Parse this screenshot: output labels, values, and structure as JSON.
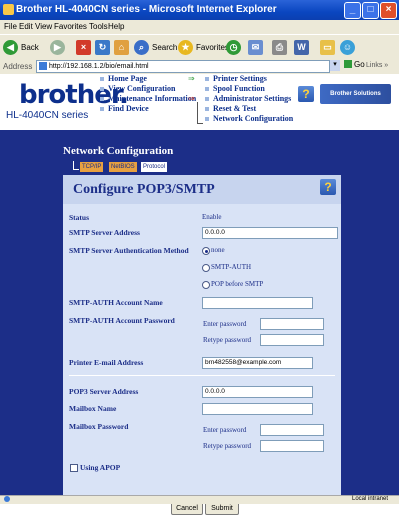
{
  "window": {
    "title": "Brother HL-4040CN series - Microsoft Internet Explorer",
    "buttons": {
      "minimize": "_",
      "maximize": "□",
      "close": "×"
    }
  },
  "menu": [
    "File",
    "Edit",
    "View",
    "Favorites",
    "Tools",
    "Help"
  ],
  "toolbar": {
    "back_label": "Back",
    "search_label": "Search",
    "favorites_label": "Favorites"
  },
  "address": {
    "label": "Address",
    "url": "http://192.168.1.2/bio/email.html",
    "go_label": "Go",
    "links_label": "Links »"
  },
  "brand": {
    "logo": "brother.",
    "model": "HL-4040CN series",
    "solutions_center": "Brother Solutions Center"
  },
  "nav": {
    "left": [
      "Home Page",
      "View Configuration",
      "Maintenance Information",
      "Find Device"
    ],
    "right": [
      "Printer Settings",
      "Spool Function",
      "Administrator Settings",
      "Reset & Test",
      "Network Configuration"
    ]
  },
  "section": {
    "title": "Network Configuration",
    "protocol_tabs": [
      "TCP/IP",
      "NetBIOS",
      "Protocol"
    ]
  },
  "form": {
    "title": "Configure POP3/SMTP",
    "status_label": "Status",
    "status_value": "Enable",
    "smtp_server_label": "SMTP Server Address",
    "smtp_server_value": "0.0.0.0",
    "smtp_auth_label": "SMTP Server Authentication Method",
    "auth_options": [
      "none",
      "SMTP-AUTH",
      "POP before SMTP"
    ],
    "auth_selected": "none",
    "smtp_account_label": "SMTP-AUTH Account Name",
    "smtp_account_value": "",
    "smtp_password_label": "SMTP-AUTH Account Password",
    "enter_password": "Enter password",
    "retype_password": "Retype password",
    "printer_email_label": "Printer E-mail Address",
    "printer_email_value": "brn482558@example.com",
    "pop3_server_label": "POP3 Server Address",
    "pop3_server_value": "0.0.0.0",
    "mailbox_name_label": "Mailbox Name",
    "mailbox_name_value": "",
    "mailbox_password_label": "Mailbox Password",
    "apop_label": "Using APOP",
    "apop_checked": false,
    "cancel_label": "Cancel",
    "submit_label": "Submit"
  },
  "status_bar": {
    "zone": "Local intranet"
  },
  "colors": {
    "accent": "#1c2e88",
    "panel": "#d9e3f6",
    "titlebar": "#0a46c0"
  }
}
